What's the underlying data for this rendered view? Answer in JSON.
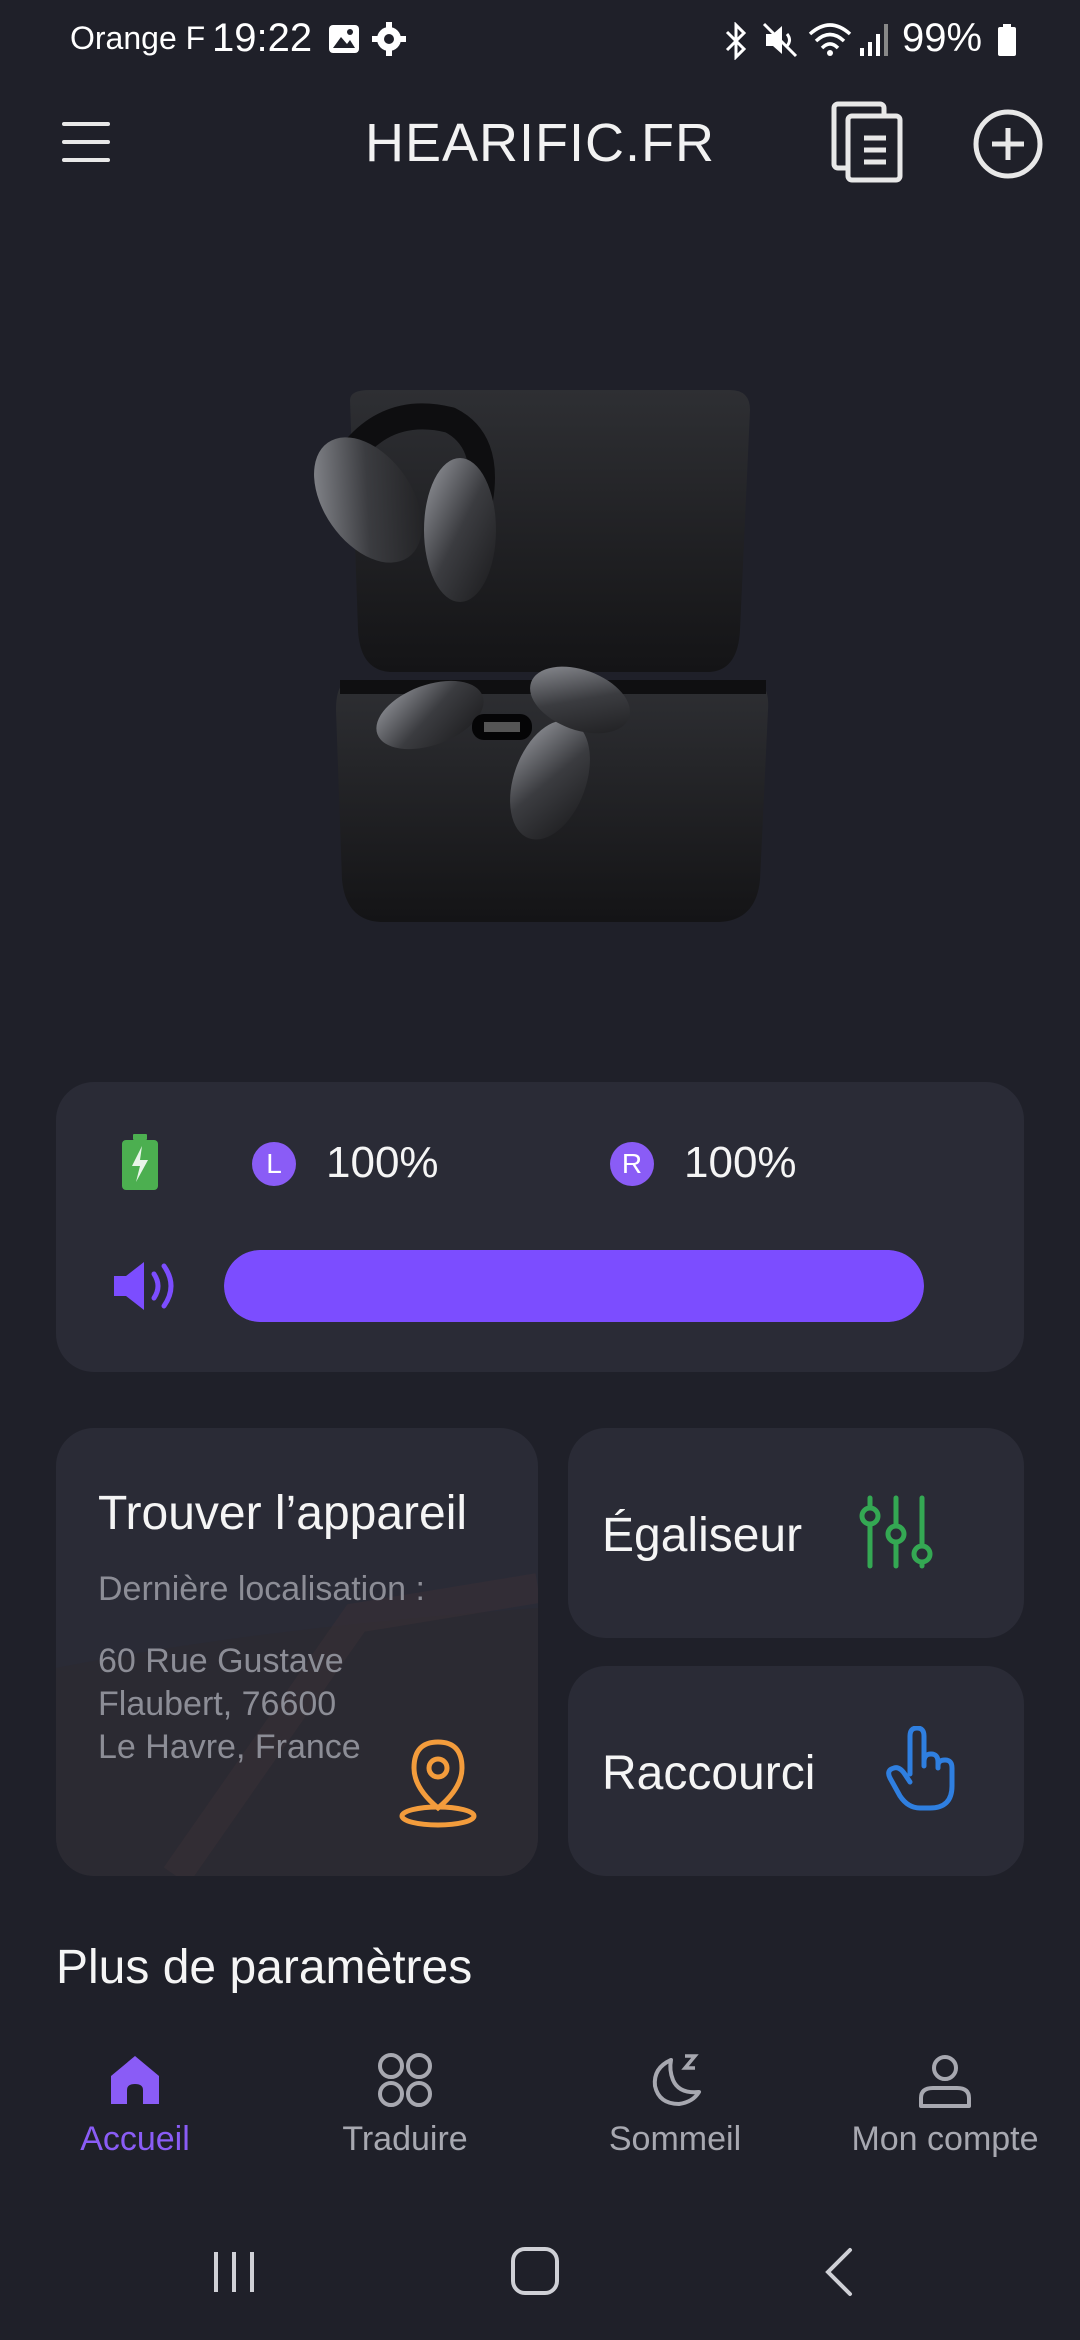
{
  "status_bar": {
    "carrier": "Orange F",
    "time": "19:22",
    "battery": "99%"
  },
  "app_bar": {
    "title": "HEARIFIC.FR"
  },
  "battery_card": {
    "left_badge": "L",
    "left_level": "100%",
    "right_badge": "R",
    "right_level": "100%",
    "volume_fraction": 1.0
  },
  "find_device": {
    "title": "Trouver l’appareil",
    "subtitle": "Dernière localisation :",
    "address_lines": [
      "60 Rue Gustave",
      "Flaubert, 76600",
      "Le Havre, France"
    ]
  },
  "equalizer": {
    "label": "Égaliseur"
  },
  "shortcut": {
    "label": "Raccourci"
  },
  "more_settings": {
    "title": "Plus de paramètres"
  },
  "bottom_nav": {
    "items": [
      {
        "label": "Accueil",
        "active": true
      },
      {
        "label": "Traduire",
        "active": false
      },
      {
        "label": "Sommeil",
        "active": false
      },
      {
        "label": "Mon compte",
        "active": false
      }
    ]
  },
  "colors": {
    "background": "#1f2029",
    "card": "#2a2b36",
    "accent": "#7c4dff",
    "battery_green": "#4caf50",
    "eq_green": "#34a853",
    "pin_orange": "#f39c3c",
    "hand_blue": "#2f7fe0"
  },
  "icons": [
    "menu-icon",
    "documents-icon",
    "add-circle-icon",
    "battery-charging-icon",
    "volume-icon",
    "location-pin-icon",
    "equalizer-icon",
    "tap-hand-icon",
    "home-icon",
    "translate-icon",
    "sleep-icon",
    "account-icon"
  ]
}
